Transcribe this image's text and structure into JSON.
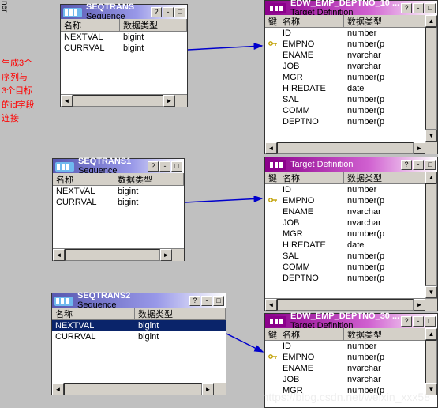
{
  "labels": {
    "name": "名称",
    "datatype": "数据类型",
    "key": "键",
    "seq_sub": "Sequence",
    "tgt_sub": "Target Definition"
  },
  "seq_rows": [
    {
      "name": "NEXTVAL",
      "type": "bigint"
    },
    {
      "name": "CURRVAL",
      "type": "bigint"
    }
  ],
  "tgt_rows": [
    {
      "k": "",
      "n": "ID",
      "t": "number"
    },
    {
      "k": "y",
      "n": "EMPNO",
      "t": "number(p"
    },
    {
      "k": "",
      "n": "ENAME",
      "t": "nvarchar"
    },
    {
      "k": "",
      "n": "JOB",
      "t": "nvarchar"
    },
    {
      "k": "",
      "n": "MGR",
      "t": "number(p"
    },
    {
      "k": "",
      "n": "HIREDATE",
      "t": "date"
    },
    {
      "k": "",
      "n": "SAL",
      "t": "number(p"
    },
    {
      "k": "",
      "n": "COMM",
      "t": "number(p"
    },
    {
      "k": "",
      "n": "DEPTNO",
      "t": "number(p"
    }
  ],
  "tgt_rows_short": [
    {
      "k": "",
      "n": "ID",
      "t": "number"
    },
    {
      "k": "y",
      "n": "EMPNO",
      "t": "number(p"
    },
    {
      "k": "",
      "n": "ENAME",
      "t": "nvarchar"
    },
    {
      "k": "",
      "n": "JOB",
      "t": "nvarchar"
    },
    {
      "k": "",
      "n": "MGR",
      "t": "number(p"
    }
  ],
  "wins": {
    "s0": "SEQTRANS",
    "s1": "SEQTRANS1",
    "s2": "SEQTRANS2",
    "t0": "EDW_EMP_DEPTNO_10 ...",
    "t2": "EDW_EMP_DEPTNO_30 ..."
  },
  "note": {
    "l1": "生成3个",
    "l2": "序列与",
    "l3": "3个目标",
    "l4": "的id字段",
    "l5": "连接"
  },
  "edge": "ner",
  "watermark": "https://blog.csdn.net/weixin_xxx58"
}
